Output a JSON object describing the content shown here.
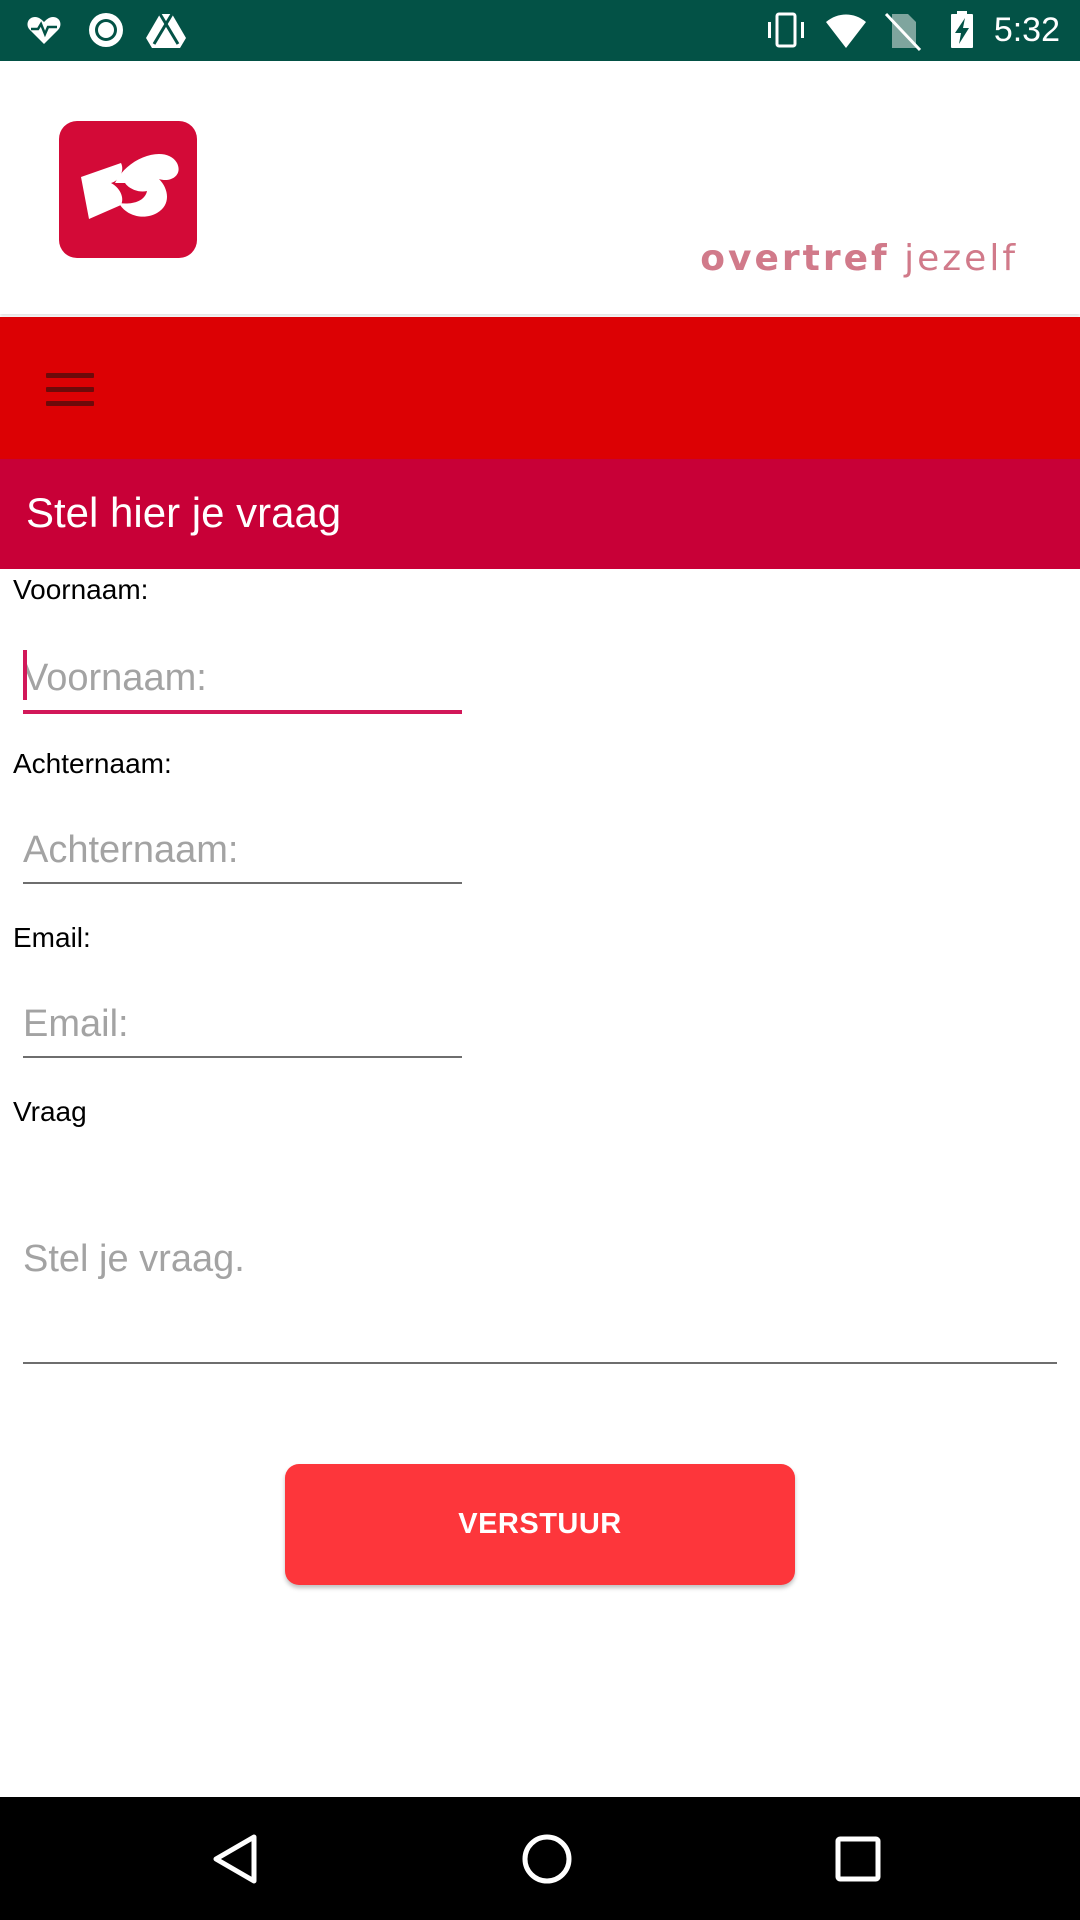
{
  "status_bar": {
    "time": "5:32",
    "left_icons": [
      "heart-monitor-icon",
      "record-icon",
      "drive-icon"
    ],
    "right_icons": [
      "vibrate-icon",
      "wifi-icon",
      "no-sim-icon",
      "battery-charging-icon"
    ]
  },
  "brand": {
    "logo": "app-logo",
    "tagline_bold": "overtref",
    "tagline_rest": "jezelf"
  },
  "toolbar": {
    "menu_icon": "hamburger-menu-icon"
  },
  "page": {
    "title": "Stel hier je vraag"
  },
  "form": {
    "first_name": {
      "label": "Voornaam:",
      "placeholder": "Voornaam:",
      "value": ""
    },
    "last_name": {
      "label": "Achternaam:",
      "placeholder": "Achternaam:",
      "value": ""
    },
    "email": {
      "label": "Email:",
      "placeholder": "Email:",
      "value": ""
    },
    "question": {
      "label": "Vraag",
      "placeholder": "Stel je vraag.",
      "value": ""
    },
    "submit_label": "VERSTUUR"
  },
  "nav_bar": {
    "back": "back-icon",
    "home": "home-icon",
    "recents": "recents-icon"
  },
  "colors": {
    "status_bar": "#035246",
    "toolbar": "#dc0104",
    "title_band": "#c80037",
    "accent": "#d21859",
    "button": "#fd363b"
  }
}
